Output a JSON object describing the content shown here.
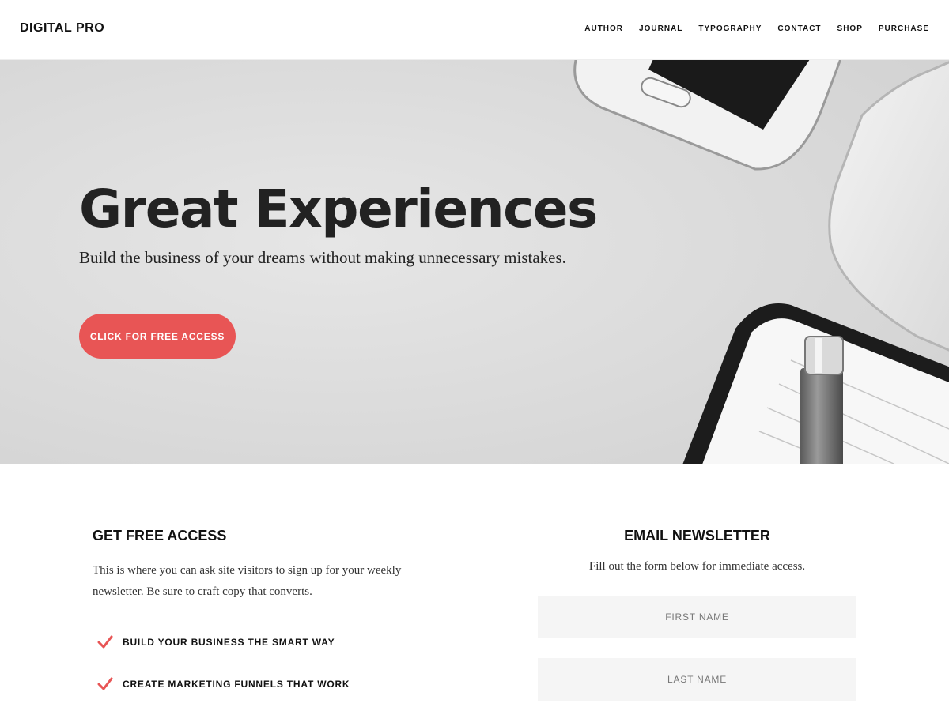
{
  "site": {
    "logo": "DIGITAL PRO"
  },
  "nav": {
    "items": [
      {
        "label": "AUTHOR"
      },
      {
        "label": "JOURNAL"
      },
      {
        "label": "TYPOGRAPHY"
      },
      {
        "label": "CONTACT"
      },
      {
        "label": "SHOP"
      },
      {
        "label": "PURCHASE"
      }
    ]
  },
  "hero": {
    "title": "Great Experiences",
    "subtitle": "Build the business of your dreams without making unnecessary mistakes.",
    "cta_label": "CLICK FOR FREE ACCESS"
  },
  "access": {
    "title": "GET FREE ACCESS",
    "body": "This is where you can ask site visitors to sign up for your weekly newsletter. Be sure to craft copy that converts.",
    "bullets": [
      {
        "label": "BUILD YOUR BUSINESS THE SMART WAY",
        "icon": "check-icon"
      },
      {
        "label": "CREATE MARKETING FUNNELS THAT WORK",
        "icon": "check-icon"
      }
    ]
  },
  "newsletter": {
    "title": "EMAIL NEWSLETTER",
    "intro": "Fill out the form below for immediate access.",
    "first_name_placeholder": "FIRST NAME",
    "last_name_placeholder": "LAST NAME"
  },
  "colors": {
    "accent": "#e85555",
    "field_bg": "#f5f5f5",
    "text": "#222222"
  }
}
